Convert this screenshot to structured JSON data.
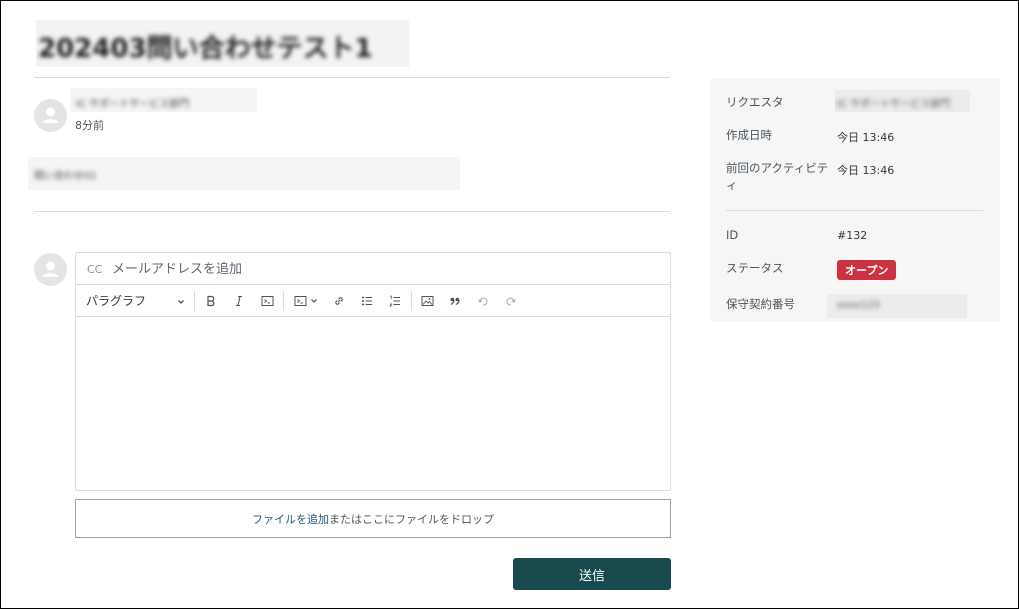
{
  "ticket": {
    "title": "202403問い合わせテスト1"
  },
  "comment": {
    "author": "IC サポートサービス部門",
    "time": "8分前",
    "body": "問い合わせ01"
  },
  "reply": {
    "cc_label": "CC",
    "cc_placeholder": "メールアドレスを追加",
    "format_label": "パラグラフ",
    "toolbar_icons": [
      "chevron-down-icon",
      "bold-icon",
      "italic-icon",
      "code-icon",
      "code-block-icon",
      "link-icon",
      "bulleted-list-icon",
      "numbered-list-icon",
      "image-icon",
      "quote-icon",
      "undo-icon",
      "redo-icon"
    ],
    "file_link": "ファイルを追加",
    "file_text": "またはここにファイルをドロップ",
    "send_label": "送信"
  },
  "sidebar": {
    "requester_label": "リクエスタ",
    "requester_value": "IC サポートサービス部門",
    "created_label": "作成日時",
    "created_value": "今日 13:46",
    "last_activity_label": "前回のアクティビティ",
    "last_activity_value": "今日 13:46",
    "id_label": "ID",
    "id_value": "#132",
    "status_label": "ステータス",
    "status_value": "オープン",
    "contract_label": "保守契約番号",
    "contract_value": "xxxx123"
  },
  "colors": {
    "send_button": "#17494d",
    "status_badge": "#cc3340",
    "sidebar_bg": "#f6f6f6"
  }
}
